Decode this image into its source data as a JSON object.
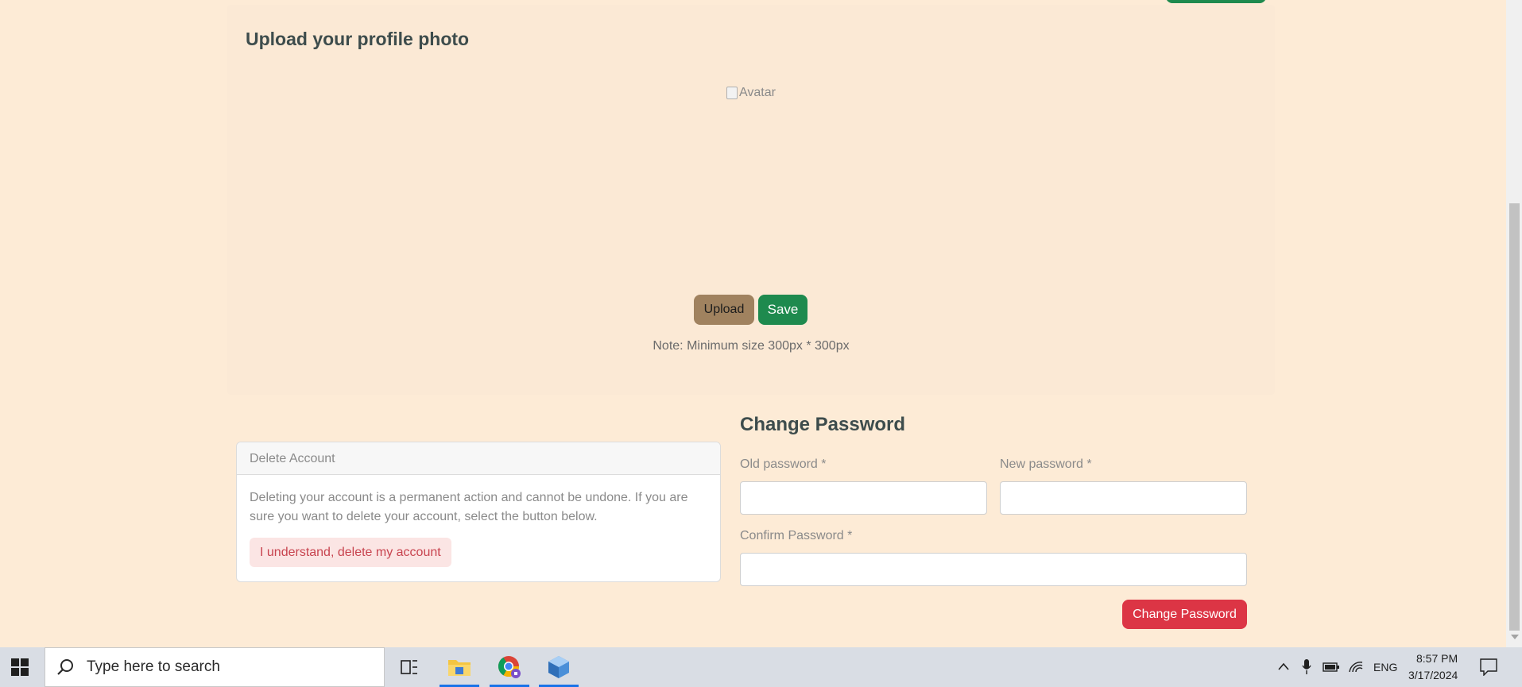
{
  "upload": {
    "title": "Upload your profile photo",
    "avatar_alt": "Avatar",
    "upload_label": "Upload",
    "save_label": "Save",
    "note": "Note: Minimum size 300px * 300px"
  },
  "delete_account": {
    "header": "Delete Account",
    "description": "Deleting your account is a permanent action and cannot be undone. If you are sure you want to delete your account, select the button below.",
    "button_label": "I understand, delete my account"
  },
  "change_password": {
    "title": "Change Password",
    "old_label": "Old password *",
    "new_label": "New password *",
    "confirm_label": "Confirm Password *",
    "old_value": "",
    "new_value": "",
    "confirm_value": "",
    "button_label": "Change Password"
  },
  "taskbar": {
    "search_placeholder": "Type here to search",
    "language": "ENG",
    "time": "8:57 PM",
    "date": "3/17/2024",
    "pinned": [
      "task-view-icon",
      "file-explorer-icon",
      "chrome-icon",
      "app-cube-icon"
    ]
  },
  "colors": {
    "page_bg": "#fdebd6",
    "accent_green": "#1e8a4e",
    "upload_brown": "#a0825f",
    "danger_red": "#dc3545"
  }
}
